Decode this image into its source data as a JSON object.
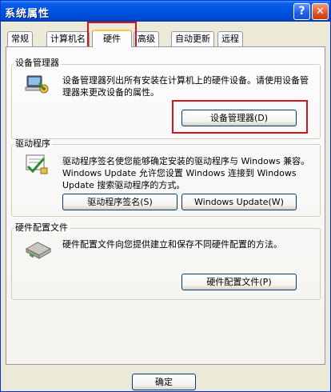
{
  "window": {
    "title": "系统属性"
  },
  "titlebar": {
    "help_label": "?",
    "close_label": "✕"
  },
  "tabs": [
    {
      "label": "常规"
    },
    {
      "label": "计算机名"
    },
    {
      "label": "硬件"
    },
    {
      "label": "高级"
    },
    {
      "label": "自动更新"
    },
    {
      "label": "远程"
    }
  ],
  "active_tab": "硬件",
  "device_manager": {
    "title": "设备管理器",
    "description": "设备管理器列出所有安装在计算机上的硬件设备。请使用设备管理器来更改设备的属性。",
    "button_label": "设备管理器(D)",
    "icon": "device-manager-icon"
  },
  "drivers": {
    "title": "驱动程序",
    "description": "驱动程序签名使您能够确定安装的驱动程序与 Windows 兼容。Windows Update 允许您设置 Windows 连接到 Windows Update 搜索驱动程序的方式。",
    "signing_button_label": "驱动程序签名(S)",
    "update_button_label": "Windows Update(W)",
    "icon": "driver-signing-icon"
  },
  "hardware_profiles": {
    "title": "硬件配置文件",
    "description": "硬件配置文件向您提供建立和保存不同硬件配置的方法。",
    "button_label": "硬件配置文件(P)",
    "icon": "hardware-profile-icon"
  },
  "footer": {
    "ok_label": "确定"
  },
  "colors": {
    "highlight_box": "#d2151b",
    "titlebar": "#0054e3",
    "active_tab_accent": "#ffc83c"
  }
}
